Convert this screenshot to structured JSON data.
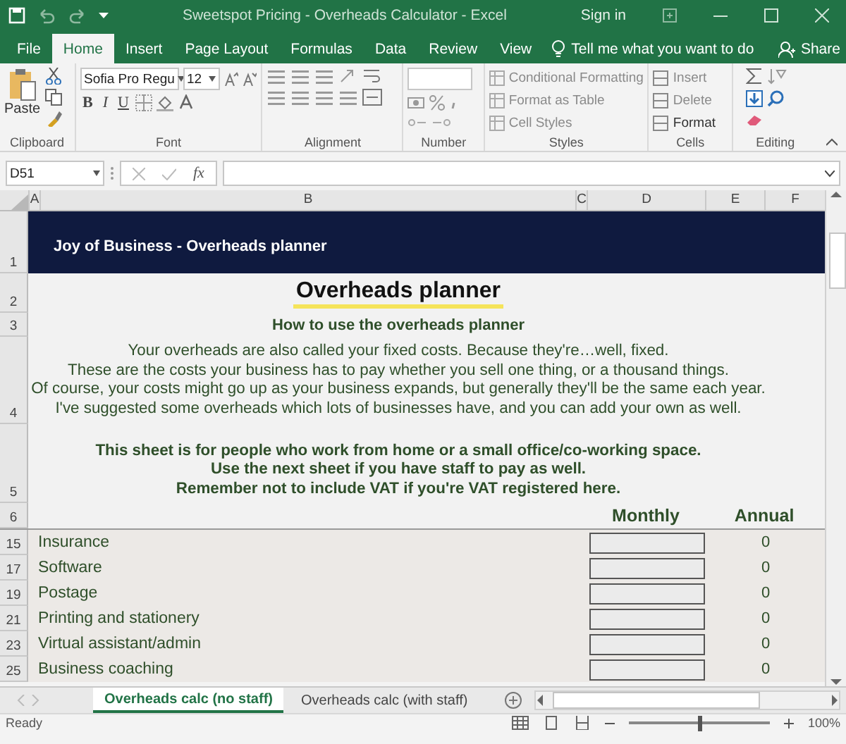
{
  "window": {
    "title": "Sweetspot Pricing - Overheads Calculator  -  Excel",
    "sign_in": "Sign in"
  },
  "ribbon_tabs": [
    {
      "label": "File",
      "selected": false
    },
    {
      "label": "Home",
      "selected": true
    },
    {
      "label": "Insert",
      "selected": false
    },
    {
      "label": "Page Layout",
      "selected": false
    },
    {
      "label": "Formulas",
      "selected": false
    },
    {
      "label": "Data",
      "selected": false
    },
    {
      "label": "Review",
      "selected": false
    },
    {
      "label": "View",
      "selected": false
    }
  ],
  "tell_me": "Tell me what you want to do",
  "share": "Share",
  "ribbon": {
    "paste": "Paste",
    "font_name": "Sofia Pro Regu",
    "font_size": "12",
    "font_styles": [
      "B",
      "I",
      "U"
    ],
    "styles_items": [
      "Conditional Formatting",
      "Format as Table",
      "Cell Styles"
    ],
    "cells_items": [
      "Insert",
      "Delete",
      "Format"
    ],
    "groups": [
      "Clipboard",
      "Font",
      "Alignment",
      "Number",
      "Styles",
      "Cells",
      "Editing"
    ]
  },
  "formula_bar": {
    "name_box": "D51",
    "fx": "fx"
  },
  "columns": [
    "A",
    "B",
    "C",
    "D",
    "E",
    "F"
  ],
  "sheet": {
    "banner": {
      "row": "1",
      "text": "Joy of Business - Overheads planner"
    },
    "title": {
      "row": "2",
      "text": "Overheads planner"
    },
    "subtitle": {
      "row": "3",
      "text": "How to use the overheads planner"
    },
    "intro": {
      "row": "4",
      "lines": [
        "Your overheads are also called your fixed costs. Because they're…well, fixed.",
        "These are the costs your business has to pay whether you sell one thing, or a thousand things.",
        "Of course, your costs might go up as your business expands, but generally they'll be the same each year.",
        "I've suggested some overheads which lots of businesses have, and you can add your own as well."
      ]
    },
    "notes": {
      "row": "5",
      "lines": [
        "This sheet is for people who work from home or a small office/co-working space.",
        "Use the next sheet if you have staff to pay as well.",
        "Remember not to include VAT if you're VAT registered here."
      ]
    },
    "headers": {
      "row": "6",
      "monthly": "Monthly",
      "annual": "Annual"
    },
    "items": [
      {
        "row": "15",
        "label": "Insurance",
        "annual": "0"
      },
      {
        "row": "17",
        "label": "Software",
        "annual": "0"
      },
      {
        "row": "19",
        "label": "Postage",
        "annual": "0"
      },
      {
        "row": "21",
        "label": "Printing and stationery",
        "annual": "0"
      },
      {
        "row": "23",
        "label": "Virtual assistant/admin",
        "annual": "0"
      },
      {
        "row": "25",
        "label": "Business coaching",
        "annual": "0"
      }
    ]
  },
  "sheet_tabs": [
    {
      "label": "Overheads calc (no staff)",
      "selected": true
    },
    {
      "label": "Overheads calc (with staff)",
      "selected": false
    }
  ],
  "status_bar": {
    "status": "Ready",
    "zoom": "100%",
    "zoom_slider": {
      "level": 0.5
    }
  }
}
